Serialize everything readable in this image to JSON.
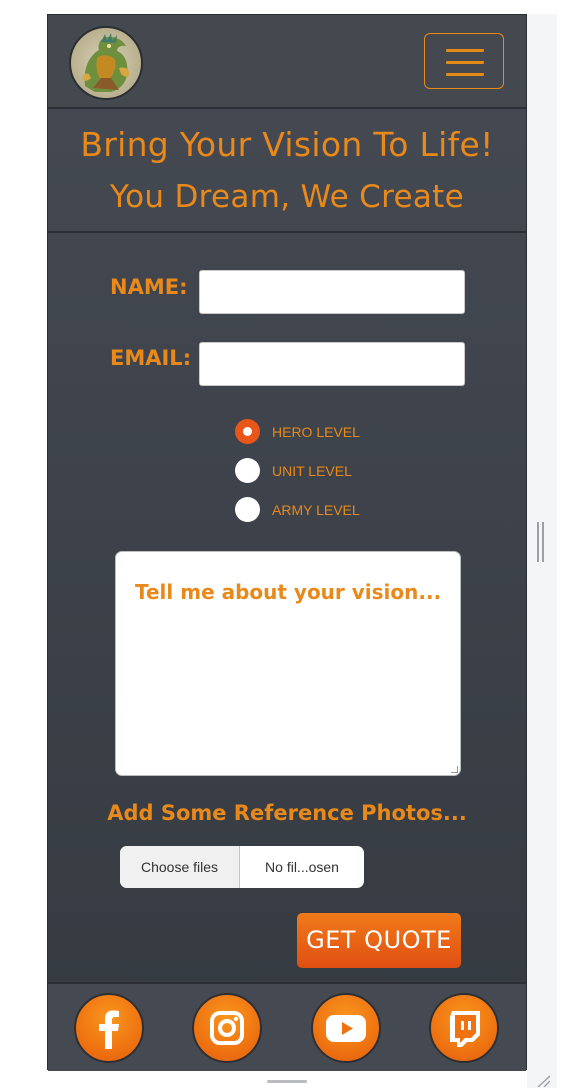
{
  "colors": {
    "accent": "#e8891a",
    "button_gradient_top": "#f07a1a",
    "button_gradient_bottom": "#e04f12",
    "panel": "#42474e"
  },
  "navbar": {
    "logo_icon": "dragon-warrior-logo",
    "menu_icon": "hamburger-menu-icon"
  },
  "hero": {
    "title": "Bring Your Vision To Life!",
    "subtitle": "You Dream, We Create"
  },
  "form": {
    "name_label": "NAME:",
    "name_value": "",
    "email_label": "EMAIL:",
    "email_value": "",
    "levels": [
      {
        "label": "HERO LEVEL",
        "checked": true
      },
      {
        "label": "UNIT LEVEL",
        "checked": false
      },
      {
        "label": "ARMY LEVEL",
        "checked": false
      }
    ],
    "vision_placeholder": "Tell me about your vision...",
    "reference_label": "Add Some Reference Photos...",
    "file_button": "Choose files",
    "file_status": "No fil...osen",
    "submit_label": "GET QUOTE"
  },
  "footer": {
    "socials": [
      {
        "name": "facebook-icon"
      },
      {
        "name": "instagram-icon"
      },
      {
        "name": "youtube-icon"
      },
      {
        "name": "twitch-icon"
      }
    ]
  }
}
